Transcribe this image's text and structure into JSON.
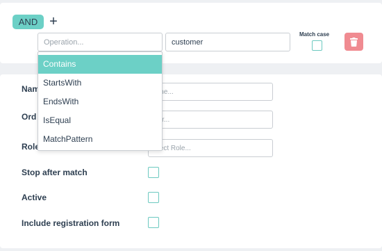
{
  "filter": {
    "and_label": "AND",
    "plus_label": "+",
    "operation_placeholder": "Operation...",
    "value": "customer",
    "match_case_label": "Match case",
    "delete_color": "#f08b91"
  },
  "dropdown": {
    "options": [
      "Contains",
      "StartsWith",
      "EndsWith",
      "IsEqual",
      "MatchPattern"
    ],
    "highlighted": "Contains"
  },
  "form": {
    "name_label": "Nam",
    "name_placeholder": "ame...",
    "order_label": "Ord",
    "order_placeholder": "der...",
    "role_label": "Role",
    "role_placeholder": "elect Role...",
    "stop_label": "Stop after match",
    "active_label": "Active",
    "include_label": "Include registration form"
  },
  "colors": {
    "accent": "#6cd0c6",
    "text": "#2d3e50",
    "danger": "#f08b91"
  }
}
